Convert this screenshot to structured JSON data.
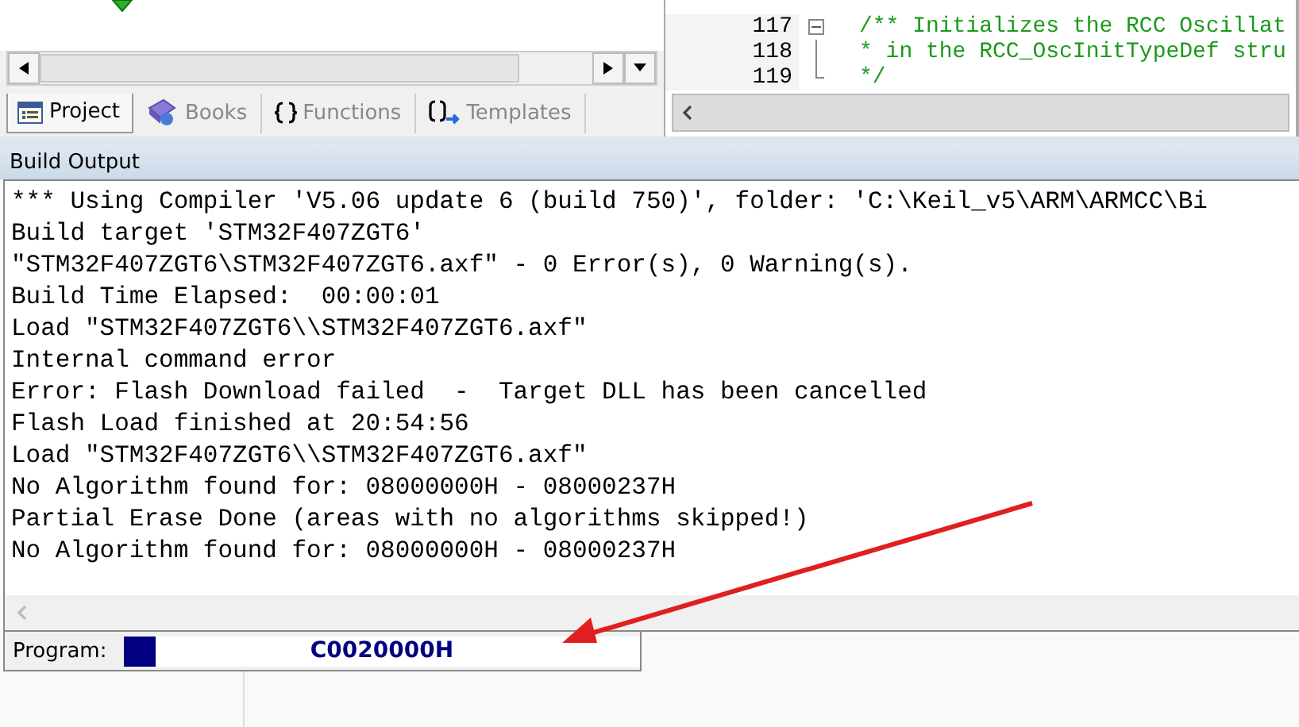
{
  "panel_tabs": [
    {
      "label": "Project",
      "selected": true,
      "kind": "project"
    },
    {
      "label": "Books",
      "selected": false,
      "kind": "books"
    },
    {
      "label": "Functions",
      "selected": false,
      "kind": "functions"
    },
    {
      "label": "Templates",
      "selected": false,
      "kind": "templates"
    }
  ],
  "editor": {
    "lines": [
      {
        "number": "117",
        "text": "/** Initializes the RCC Oscillat",
        "kind": "fold-start"
      },
      {
        "number": "118",
        "text": "* in the RCC_OscInitTypeDef stru",
        "kind": "fold-line"
      },
      {
        "number": "119",
        "text": "*/",
        "kind": "fold-end"
      }
    ]
  },
  "build_output": {
    "title": "Build Output",
    "lines": [
      "*** Using Compiler 'V5.06 update 6 (build 750)', folder: 'C:\\Keil_v5\\ARM\\ARMCC\\Bi",
      "Build target 'STM32F407ZGT6'",
      "\"STM32F407ZGT6\\STM32F407ZGT6.axf\" - 0 Error(s), 0 Warning(s).",
      "Build Time Elapsed:  00:00:01",
      "Load \"STM32F407ZGT6\\\\STM32F407ZGT6.axf\"",
      "Internal command error",
      "Error: Flash Download failed  -  Target DLL has been cancelled",
      "Flash Load finished at 20:54:56",
      "Load \"STM32F407ZGT6\\\\STM32F407ZGT6.axf\"",
      "No Algorithm found for: 08000000H - 08000237H",
      "Partial Erase Done (areas with no algorithms skipped!)",
      "No Algorithm found for: 08000000H - 08000237H"
    ]
  },
  "status_bar": {
    "label": "Program:",
    "level": 0.06,
    "value": "C0020000H"
  }
}
